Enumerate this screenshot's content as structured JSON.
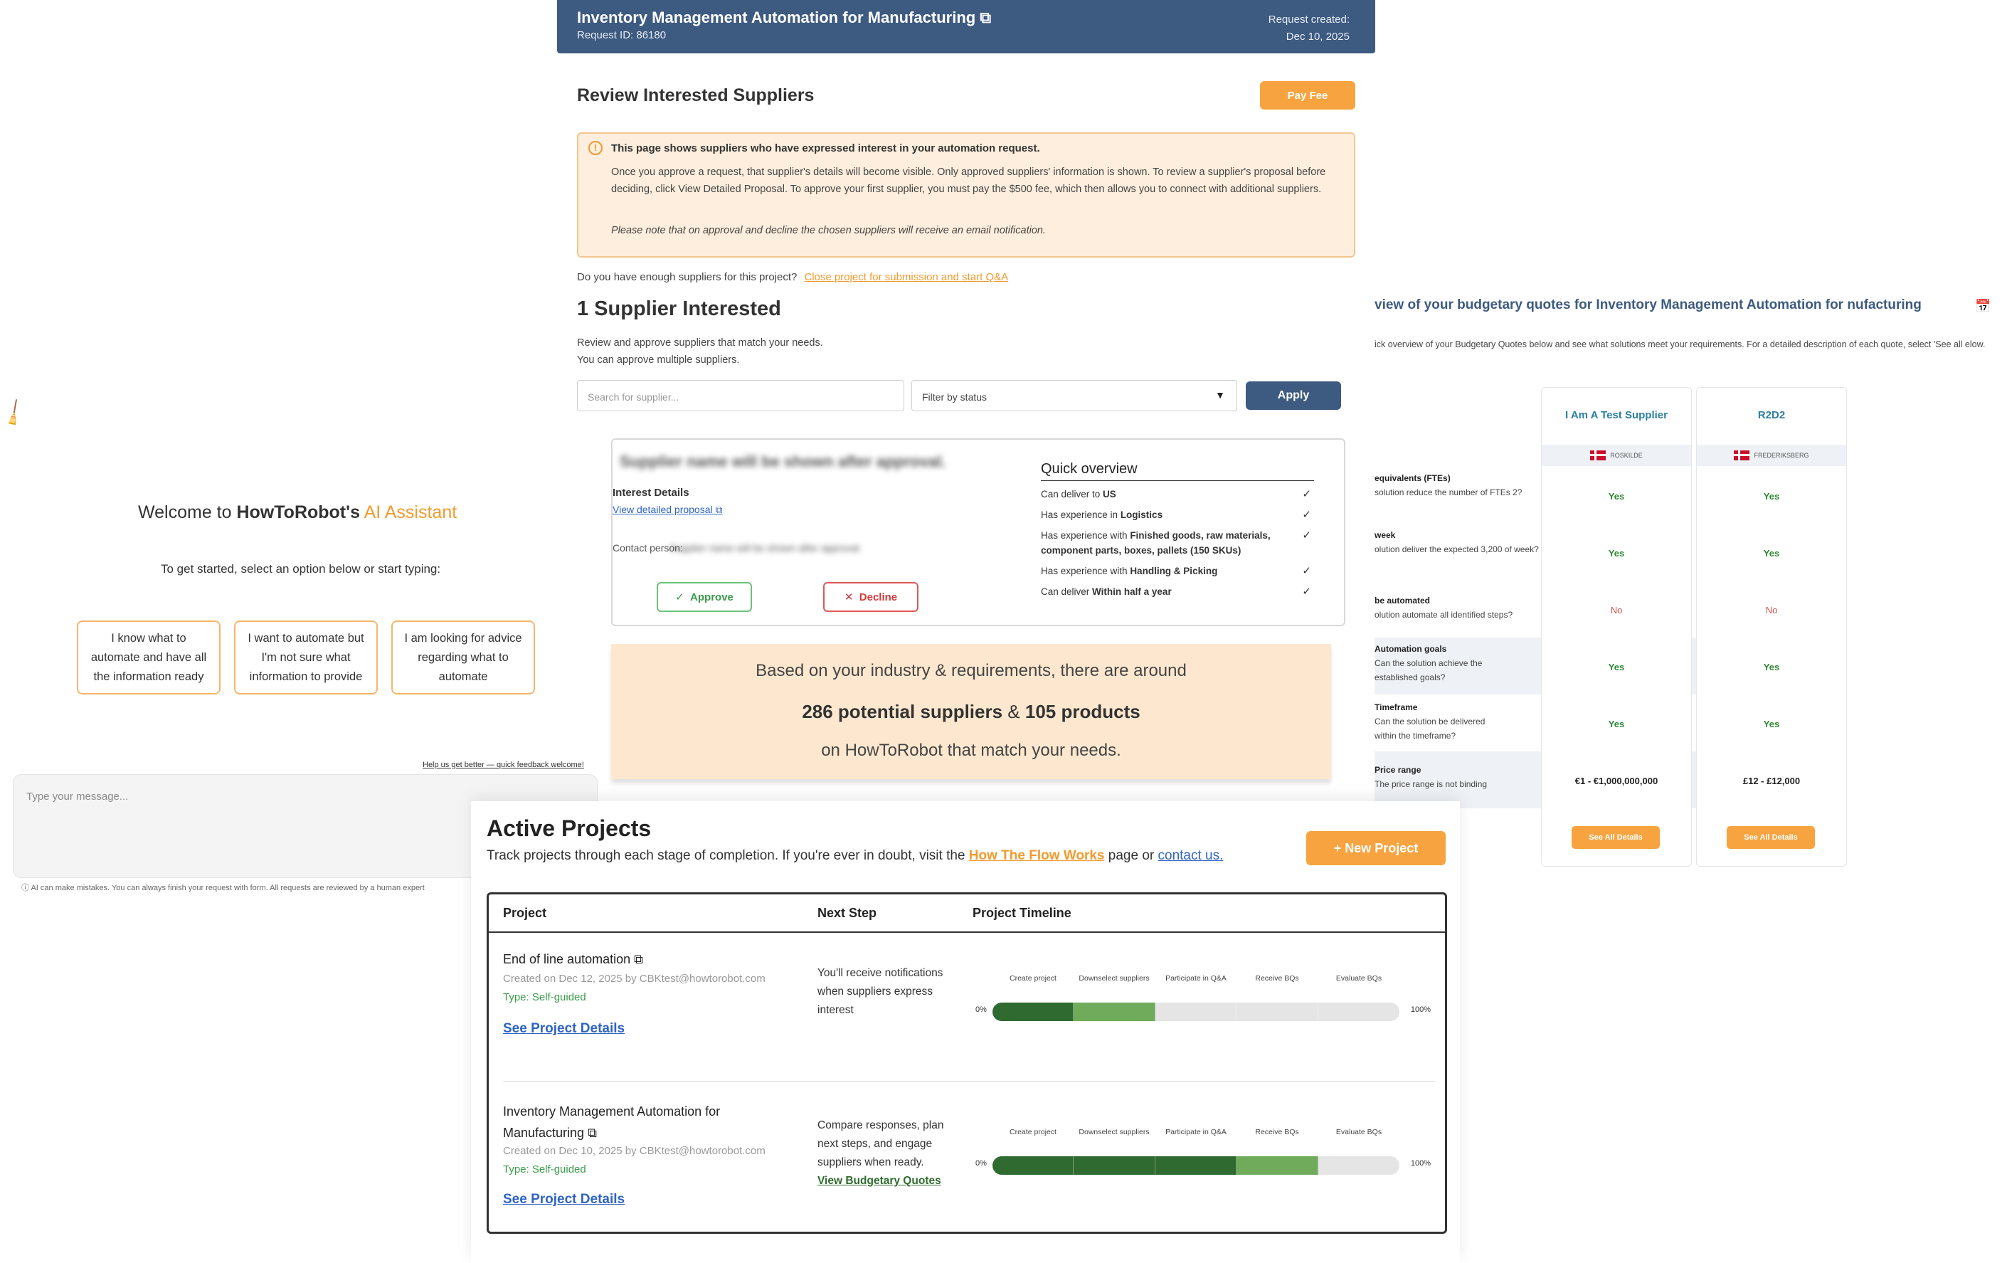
{
  "chat": {
    "welcome_prefix": "Welcome to ",
    "welcome_brand": "HowToRobot's",
    "welcome_accent": "AI Assistant",
    "intro": "To get started, select an option below or start typing:",
    "options": [
      "I know what to automate and have all the information ready",
      "I want to automate but I'm not sure what information to provide",
      "I am looking for advice regarding what to automate"
    ],
    "feedback_link": "Help us get better — quick feedback welcome!",
    "message_placeholder": "Type your message...",
    "disclaimer": "AI can make mistakes. You can always finish your request with form. All requests are reviewed by a human expert"
  },
  "request": {
    "title": "Inventory Management Automation for Manufacturing",
    "request_id": "Request ID: 86180",
    "created_label": "Request created:",
    "created_date": "Dec 10, 2025",
    "heading": "Review Interested Suppliers",
    "pay_fee": "Pay Fee",
    "info_title": "This page shows suppliers who have expressed interest in your automation request.",
    "info_body": "Once you approve a request, that supplier's details will become visible. Only approved suppliers' information is shown. To review a supplier's proposal before deciding, click View Detailed Proposal. To approve your first supplier, you must pay the $500 fee, which then allows you to connect with additional suppliers.",
    "info_note": "Please note that on approval and decline the chosen suppliers will receive an email notification.",
    "enough_question": "Do you have enough suppliers for this project?",
    "close_project_link": "Close project for submission and start Q&A",
    "supplier_count": "1 Supplier Interested",
    "sub_line1": "Review and approve suppliers that match your needs.",
    "sub_line2": "You can approve multiple suppliers.",
    "search_placeholder": "Search for supplier...",
    "filter_placeholder": "Filter by status",
    "apply": "Apply",
    "card": {
      "hidden_name": "Supplier name will be shown after approval.",
      "interest_details": "Interest Details",
      "view_proposal": "View detailed proposal",
      "contact_label": "Contact person:",
      "contact_hidden": "Supplier name will be shown after approval",
      "approve": "Approve",
      "decline": "Decline",
      "overview_title": "Quick overview",
      "overview": [
        {
          "pre": "Can deliver to ",
          "bold": "US"
        },
        {
          "pre": "Has experience in ",
          "bold": "Logistics"
        },
        {
          "pre": "Has experience with ",
          "bold": "Finished goods, raw materials, component parts, boxes, pallets (150 SKUs)"
        },
        {
          "pre": "Has experience with ",
          "bold": "Handling & Picking"
        },
        {
          "pre": "Can deliver ",
          "bold": "Within half a year"
        }
      ],
      "check": "✓"
    },
    "banner": {
      "line1": "Based on your industry & requirements, there are around",
      "suppliers": "286 potential suppliers",
      "amp": " & ",
      "products": "105 products",
      "line3": "on HowToRobot that match your needs."
    }
  },
  "quotes": {
    "title": "view of your budgetary quotes for Inventory Management Automation for nufacturing",
    "desc": "ick overview of your Budgetary Quotes below and see what solutions meet your requirements. For a detailed description of each quote, select 'See all elow.",
    "rows": [
      {
        "title": "equivalents (FTEs)",
        "desc": "solution reduce the number of FTEs 2?"
      },
      {
        "title": "week",
        "desc": "olution deliver the expected 3,200 of week?"
      },
      {
        "title": "be automated",
        "desc": "olution automate all identified steps?"
      },
      {
        "title": "Automation goals",
        "desc": "Can the solution achieve the established goals?"
      },
      {
        "title": "Timeframe",
        "desc": "Can the solution be delivered within the timeframe?"
      },
      {
        "title": "Price range",
        "desc": "The price range is not binding"
      }
    ],
    "suppliers": [
      {
        "name": "I Am A Test Supplier",
        "location": "ROSKILDE",
        "cells": [
          "Yes",
          "Yes",
          "No",
          "Yes",
          "Yes",
          "€1 - €1,000,000,000"
        ],
        "see_all": "See All Details"
      },
      {
        "name": "R2D2",
        "location": "FREDERIKSBERG",
        "cells": [
          "Yes",
          "Yes",
          "No",
          "Yes",
          "Yes",
          "£12 - £12,000"
        ],
        "see_all": "See All Details"
      }
    ]
  },
  "projects": {
    "title": "Active Projects",
    "sub_pre": "Track projects through each stage of completion. If you're ever in doubt, visit the ",
    "sub_link": "How The Flow Works",
    "sub_mid": " page or ",
    "sub_contact": "contact us.",
    "new_project": "+ New Project",
    "headers": {
      "project": "Project",
      "next_step": "Next Step",
      "timeline": "Project Timeline"
    },
    "stages": [
      "Create project",
      "Downselect suppliers",
      "Participate in Q&A",
      "Receive BQs",
      "Evaluate BQs"
    ],
    "p0": "0%",
    "p100": "100%",
    "details_link": "See Project Details",
    "items": [
      {
        "name": "End of line automation",
        "meta": "Created on Dec 12, 2025 by CBKtest@howtorobot.com",
        "type": "Type: Self-guided",
        "next": "You'll receive notifications when suppliers express interest",
        "next_link": "",
        "stage_status": [
          "done",
          "cur",
          "todo",
          "todo",
          "todo"
        ]
      },
      {
        "name": "Inventory Management Automation for Manufacturing",
        "meta": "Created on Dec 10, 2025 by CBKtest@howtorobot.com",
        "type": "Type: Self-guided",
        "next": "Compare responses, plan next steps, and engage suppliers when ready.",
        "next_link": "View Budgetary Quotes",
        "stage_status": [
          "done",
          "done",
          "done",
          "cur",
          "todo"
        ]
      }
    ]
  },
  "colors": {
    "accent": "#f7a440",
    "navy": "#3d5a80",
    "done": "#2f6a30",
    "current": "#6fab5b"
  }
}
